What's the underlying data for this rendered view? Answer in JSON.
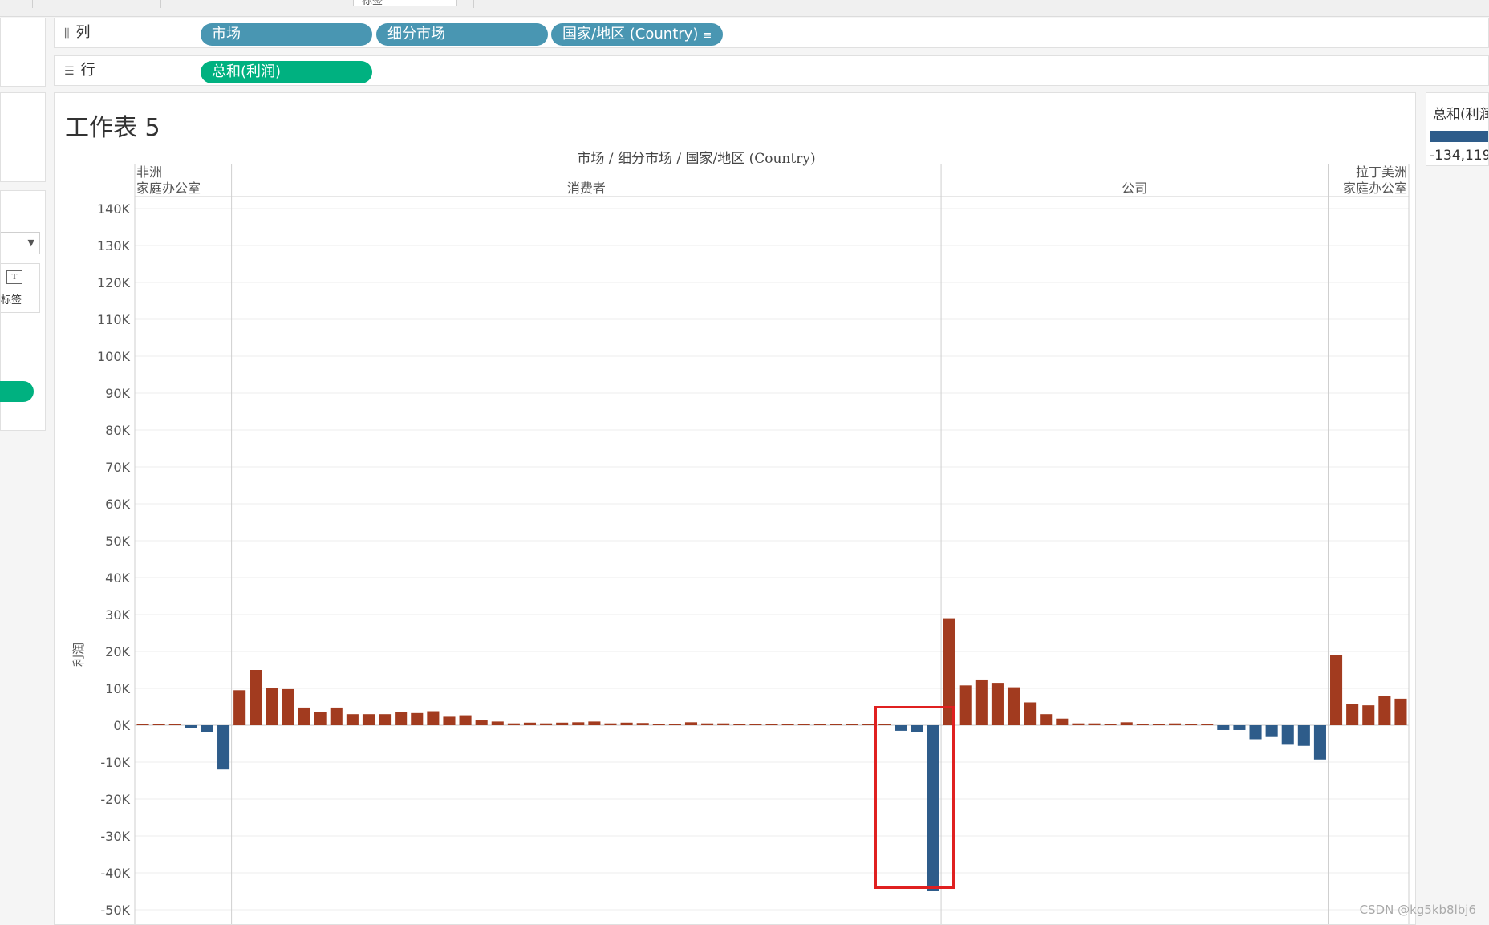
{
  "toolbar": {
    "partial_box": "标签"
  },
  "shelves": {
    "columns": {
      "label": "列",
      "icon": "columns-icon",
      "pills": [
        "市场",
        "细分市场",
        "国家/地区 (Country)"
      ],
      "sort_icon": "sort-icon"
    },
    "rows": {
      "label": "行",
      "icon": "rows-icon",
      "pills": [
        "总和(利润)"
      ]
    }
  },
  "marks_card": {
    "label_button": "标签"
  },
  "sheet": {
    "title": "工作表 5"
  },
  "legend": {
    "title": "总和(利润)",
    "value": "-134,119",
    "color": "#2e5c8a"
  },
  "watermark": "CSDN @kg5kb8lbj6",
  "chart_data": {
    "type": "bar",
    "header_title": "市场 / 细分市场 / 国家/地区 (Country)",
    "ylabel": "利润",
    "ylim": [
      -50000,
      140000
    ],
    "yticks": [
      "140K",
      "130K",
      "120K",
      "110K",
      "100K",
      "90K",
      "80K",
      "70K",
      "60K",
      "50K",
      "40K",
      "30K",
      "20K",
      "10K",
      "0K",
      "-10K",
      "-20K",
      "-30K",
      "-40K",
      "-50K"
    ],
    "grid": true,
    "colors": {
      "positive": "#a23b1f",
      "negative": "#2e5c8a"
    },
    "panes": [
      {
        "market": "非洲",
        "segment": "家庭办公室",
        "values": [
          150,
          100,
          100,
          -700,
          -1800,
          -12000
        ]
      },
      {
        "market": "",
        "segment": "消费者",
        "values": [
          9500,
          15000,
          10000,
          9800,
          4800,
          3500,
          4800,
          3000,
          3000,
          3000,
          3500,
          3300,
          3800,
          2300,
          2700,
          1300,
          1000,
          500,
          700,
          500,
          700,
          800,
          1000,
          500,
          700,
          600,
          400,
          200,
          800,
          500,
          500,
          300,
          300,
          300,
          300,
          300,
          200,
          200,
          200,
          200,
          100,
          -1500,
          -1800,
          -45000
        ]
      },
      {
        "market": "",
        "segment": "公司",
        "values": [
          29000,
          10800,
          12400,
          11500,
          10300,
          6200,
          3000,
          1800,
          500,
          500,
          300,
          800,
          200,
          300,
          500,
          200,
          200,
          -1300,
          -1300,
          -3800,
          -3200,
          -5300,
          -5600,
          -9300
        ]
      },
      {
        "market": "拉丁美洲",
        "segment": "家庭办公室",
        "values": [
          19000,
          5800,
          5400,
          8000,
          7200
        ]
      }
    ]
  }
}
